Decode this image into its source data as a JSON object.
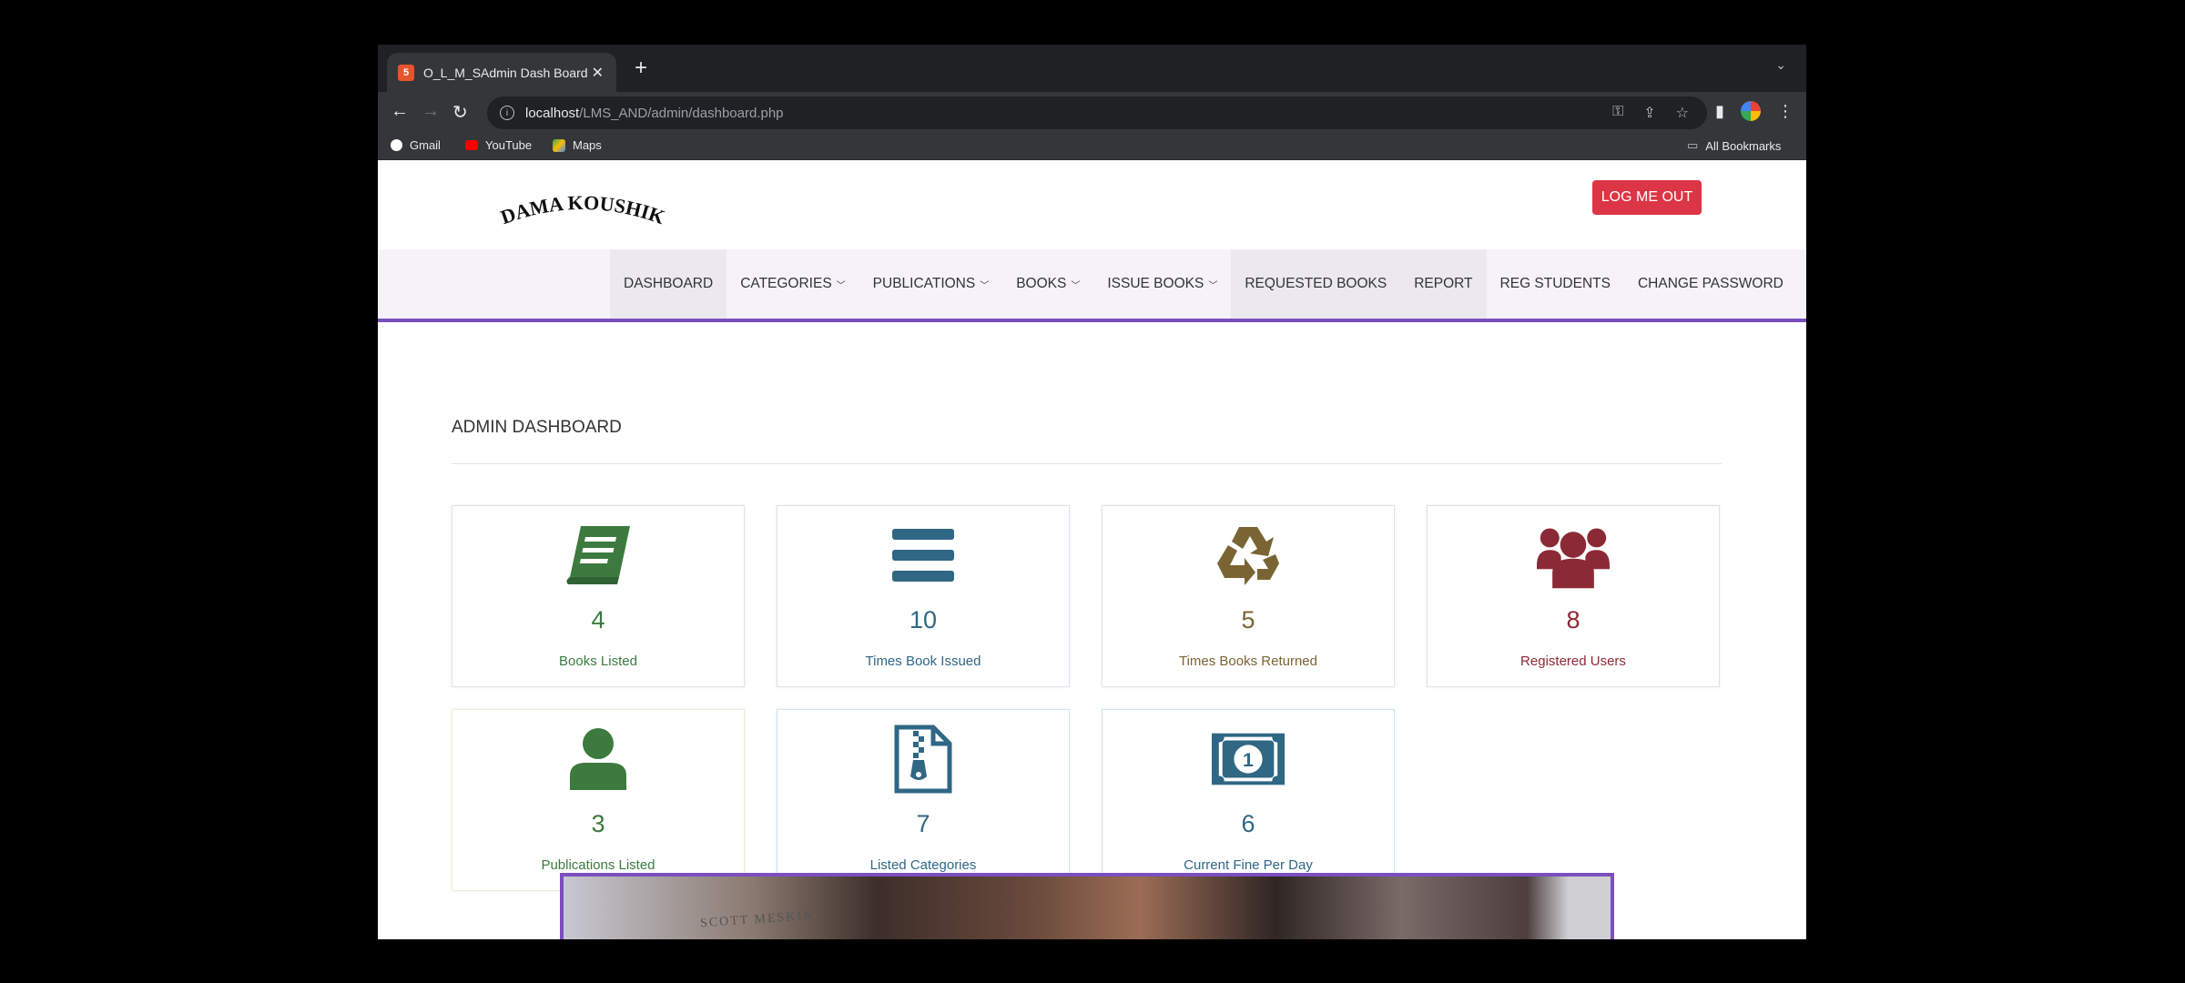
{
  "browser": {
    "tab_title": "O_L_M_SAdmin Dash Board",
    "favicon": "html-icon",
    "url_host": "localhost",
    "url_path": "/LMS_AND/admin/dashboard.php",
    "bookmarks": [
      "Gmail",
      "YouTube",
      "Maps"
    ],
    "all_bookmarks": "All Bookmarks"
  },
  "header": {
    "logo_text": "DAMA KOUSHIK",
    "logout_label": "LOG ME OUT"
  },
  "nav": {
    "items": [
      {
        "label": "DASHBOARD"
      },
      {
        "label": "CATEGORIES"
      },
      {
        "label": "PUBLICATIONS"
      },
      {
        "label": "BOOKS"
      },
      {
        "label": "ISSUE BOOKS"
      },
      {
        "label": "REQUESTED BOOKS"
      },
      {
        "label": "REPORT"
      },
      {
        "label": "REG STUDENTS"
      },
      {
        "label": "CHANGE PASSWORD"
      }
    ]
  },
  "dashboard": {
    "title": "ADMIN DASHBOARD",
    "cards": [
      {
        "value": "4",
        "label": "Books Listed",
        "icon": "book-icon",
        "color": "#3c7a3f"
      },
      {
        "value": "10",
        "label": "Times Book Issued",
        "icon": "list-icon",
        "color": "#2f6784"
      },
      {
        "value": "5",
        "label": "Times Books Returned",
        "icon": "recycle-icon",
        "color": "#7a6433"
      },
      {
        "value": "8",
        "label": "Registered Users",
        "icon": "users-icon",
        "color": "#8b2a36"
      },
      {
        "value": "3",
        "label": "Publications Listed",
        "icon": "user-icon",
        "color": "#3c7a3f"
      },
      {
        "value": "7",
        "label": "Listed Categories",
        "icon": "file-archive-icon",
        "color": "#2f6784"
      },
      {
        "value": "6",
        "label": "Current Fine Per Day",
        "icon": "money-icon",
        "color": "#2f6784"
      }
    ]
  },
  "banner": {
    "text": "SCOTT MESKIN"
  }
}
